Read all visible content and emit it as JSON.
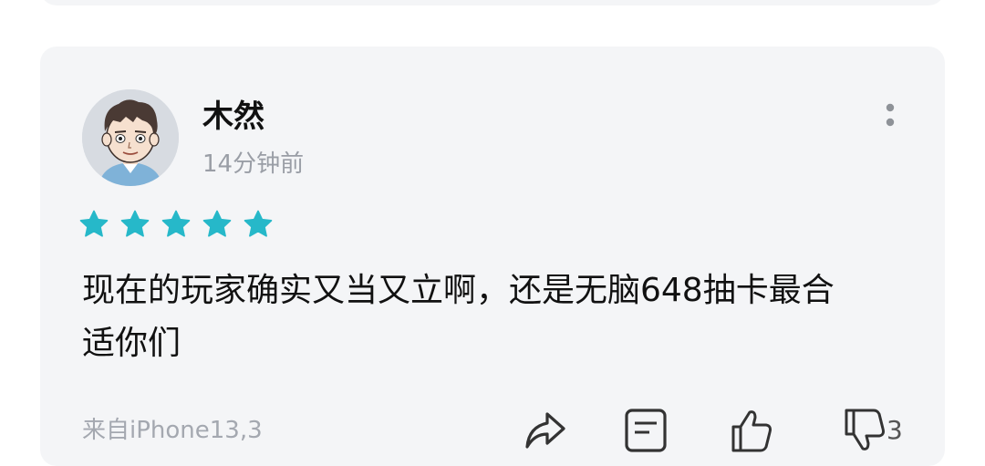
{
  "review": {
    "username": "木然",
    "time": "14分钟前",
    "rating": 5,
    "comment_lines": [
      "现在的玩家确实又当又立啊，还是无脑648抽卡最合",
      "适你们"
    ],
    "device": "来自iPhone13,3",
    "dislike_count": "3"
  },
  "icons": {
    "more": "more-vertical-icon",
    "share": "share-icon",
    "reply": "comment-icon",
    "like": "thumbs-up-icon",
    "dislike": "thumbs-down-icon"
  },
  "colors": {
    "star": "#26b8c9",
    "card_bg": "#f4f5f7",
    "muted_text": "#9a9ea6"
  }
}
